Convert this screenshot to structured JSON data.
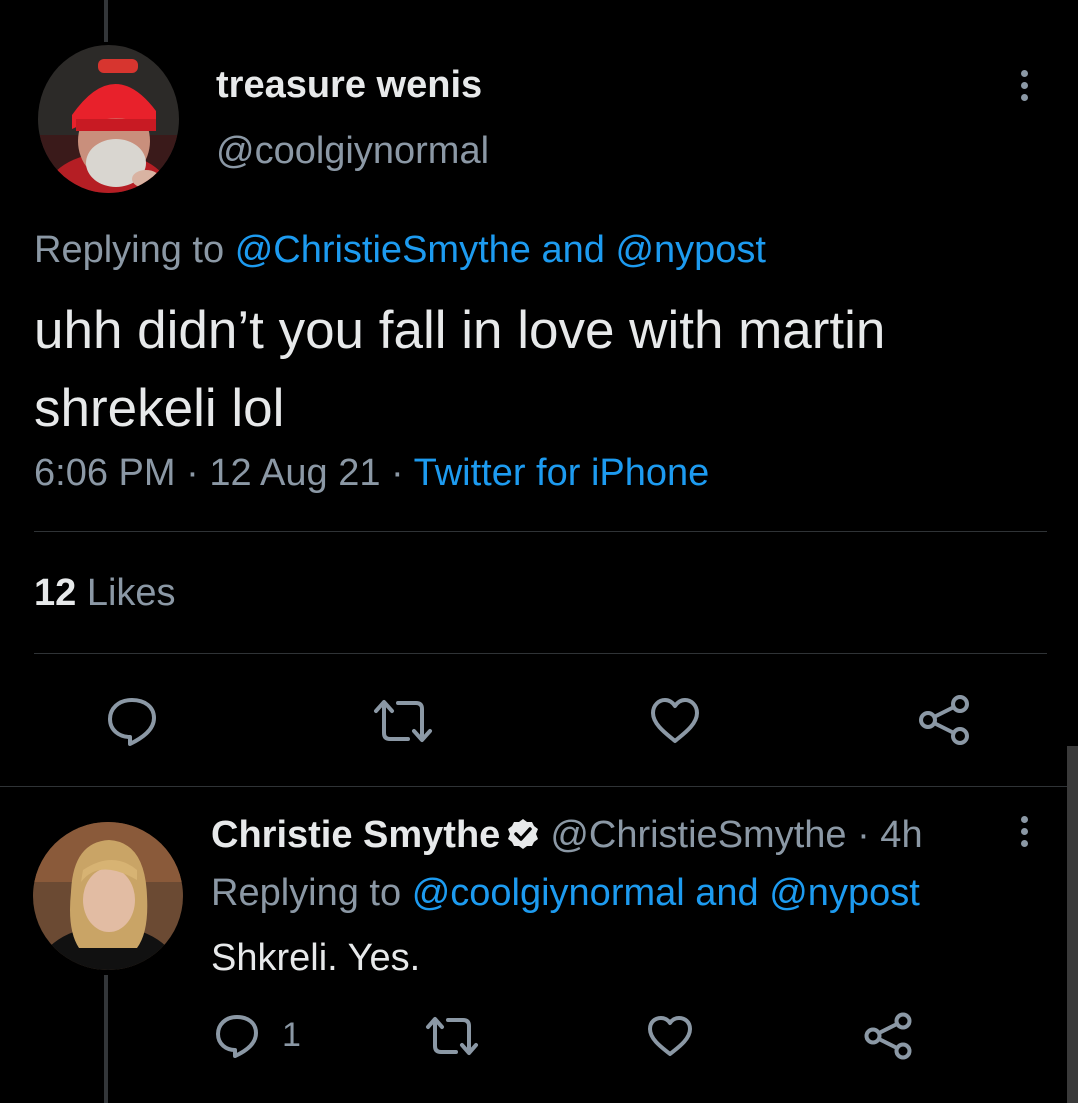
{
  "main_tweet": {
    "author_name": "treasure wenis",
    "author_handle": "@coolgiynormal",
    "replying_prefix": "Replying to",
    "replying_to_1": "@ChristieSmythe",
    "replying_and": "and",
    "replying_to_2": "@nypost",
    "text": "uhh didn’t you fall in love with martin shrekeli lol",
    "time": "6:06 PM",
    "separator": "·",
    "date": "12 Aug 21",
    "source": "Twitter for iPhone",
    "likes_count": "12",
    "likes_label": "Likes",
    "avatar_icon": "avatar-man-red-beanie"
  },
  "reply_tweet": {
    "author_name": "Christie Smythe",
    "author_handle": "@ChristieSmythe",
    "age": "· 4h",
    "replying_prefix": "Replying to",
    "replying_to_1": "@coolgiynormal",
    "replying_and": "and",
    "replying_to_2": "@nypost",
    "text": "Shkreli. Yes.",
    "reply_count": "1",
    "avatar_icon": "avatar-woman-blonde"
  },
  "colors": {
    "background": "#000000",
    "text": "#e7e9ea",
    "muted": "#8b98a5",
    "link": "#1d9bf0",
    "divider": "#2f3336"
  },
  "icons": [
    "more-icon",
    "reply-icon",
    "retweet-icon",
    "like-icon",
    "share-icon",
    "verified-badge-icon"
  ]
}
